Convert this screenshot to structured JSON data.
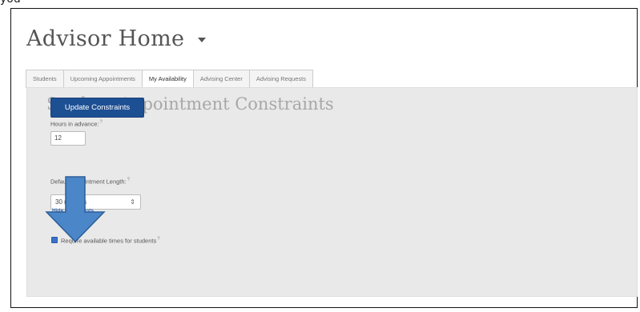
{
  "window": {
    "top_sliver_text": "you"
  },
  "header": {
    "title": "Advisor Home"
  },
  "tabs": [
    {
      "label": "Students"
    },
    {
      "label": "Upcoming Appointments"
    },
    {
      "label": "My Availability",
      "active": true
    },
    {
      "label": "Advising Center"
    },
    {
      "label": "Advising Requests"
    }
  ],
  "constraints": {
    "title": "Student Appointment Constraints",
    "hours_label": "Hours in advance:",
    "help_mark": "?",
    "hours_value": "12",
    "length_label": "Default Appointment Length:",
    "length_value": "30 minutes",
    "require_label": "Require available times for students",
    "require_checked": true,
    "update_label": "Update Constraints",
    "hide_label": "Hide Constraints"
  },
  "annotation": {
    "arrow_color": "#4a86c8",
    "arrow_outline": "#2c5f98"
  }
}
